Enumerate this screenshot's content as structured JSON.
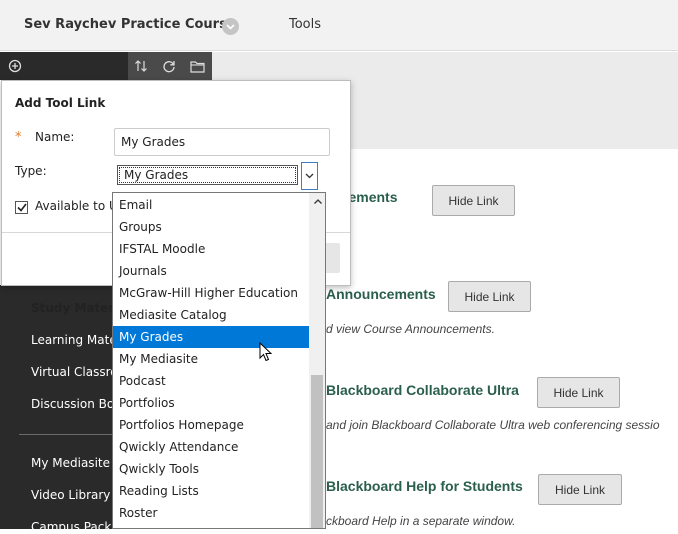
{
  "header": {
    "course_title": "Sev Raychev Practice Course",
    "tools_label": "Tools"
  },
  "nav": {
    "section_heading": "Study Materi",
    "items": [
      "Learning Mate",
      "Virtual Classro",
      "Discussion Bo",
      "My Mediasite",
      "Video Library",
      "Campus Pack"
    ]
  },
  "panel": {
    "title": "Add Tool Link",
    "name_label": "Name:",
    "name_value": "My Grades",
    "type_label": "Type:",
    "type_selected": "My Grades",
    "available_label": "Available to U",
    "available_checked": true
  },
  "dropdown": {
    "options": [
      "Email",
      "Groups",
      "IFSTAL Moodle",
      "Journals",
      "McGraw-Hill Higher Education",
      "Mediasite Catalog",
      "My Grades",
      "My Mediasite",
      "Podcast",
      "Portfolios",
      "Portfolios Homepage",
      "Qwickly Attendance",
      "Qwickly Tools",
      "Reading Lists",
      "Roster"
    ],
    "highlighted": "My Grades"
  },
  "content": {
    "items": [
      {
        "title": "ievements",
        "description": "",
        "button": "Hide Link"
      },
      {
        "title": "Announcements",
        "description": "d view Course Announcements.",
        "button": "Hide Link"
      },
      {
        "title": "Blackboard Collaborate Ultra",
        "description": "and join Blackboard Collaborate Ultra web conferencing sessio",
        "button": "Hide Link"
      },
      {
        "title": "Blackboard Help for Students",
        "description": "ckboard Help in a separate window.",
        "button": "Hide Link"
      }
    ]
  },
  "colors": {
    "accent": "#0078d7",
    "nav_bg": "#2a2a2a",
    "link_title": "#2a5e4e",
    "required": "#e07a2c"
  },
  "icons": [
    "chevron-down-icon",
    "add-circle-icon",
    "sort-icon",
    "refresh-icon",
    "folder-icon",
    "checkmark-icon",
    "chevron-up-icon",
    "mouse-pointer-icon"
  ]
}
